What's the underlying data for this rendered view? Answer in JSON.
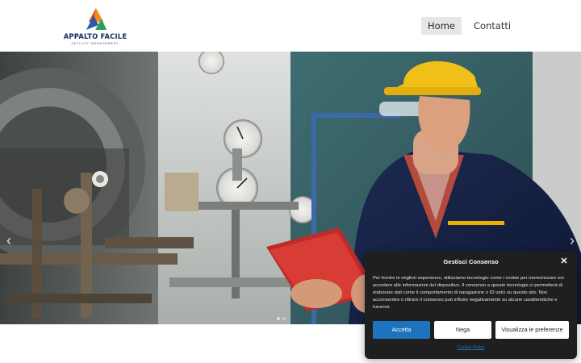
{
  "brand": {
    "name": "APPALTO FACILE",
    "tagline": "FACILITY MANAGEMENT",
    "colors": {
      "orange": "#f08a1c",
      "blue": "#2b5aa8",
      "green": "#2e9e5b",
      "red": "#d93a2b",
      "navy": "#1c2a63"
    }
  },
  "nav": {
    "home": "Home",
    "contact": "Contatti"
  },
  "hero": {
    "icons": {
      "prev": "chevron-left-icon",
      "next": "chevron-right-icon"
    },
    "slides_total": 2,
    "slide_active": 1
  },
  "cookie": {
    "title": "Gestisci Consenso",
    "body": "Per fornire le migliori esperienze, utilizziamo tecnologie come i cookie per memorizzare e/o accedere alle informazioni del dispositivo. Il consenso a queste tecnologie ci permetterà di elaborare dati come il comportamento di navigazione o ID unici su questo sito. Non acconsentire o ritirare il consenso può influire negativamente su alcune caratteristiche e funzioni.",
    "accept": "Accetta",
    "deny": "Nega",
    "preferences": "Visualizza le preferenze",
    "policy": "Cookie Policy",
    "accent": "#1e73be"
  }
}
